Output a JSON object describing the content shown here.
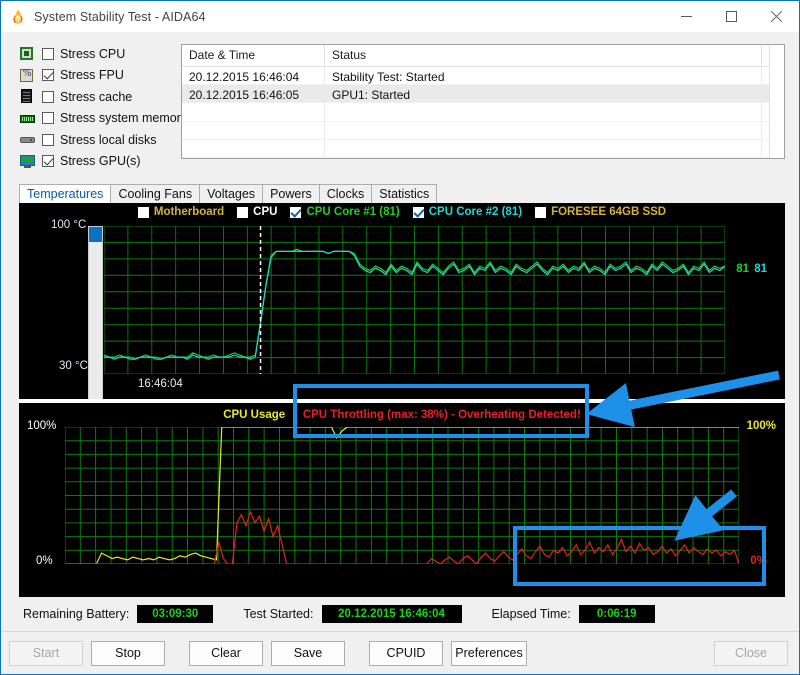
{
  "window": {
    "title": "System Stability Test - AIDA64",
    "icon": "flame-icon",
    "minimize": "—",
    "maximize": "□",
    "close": "✕"
  },
  "stress_options": [
    {
      "label": "Stress CPU",
      "checked": false,
      "icon": "cpu-chip-icon"
    },
    {
      "label": "Stress FPU",
      "checked": true,
      "icon": "fpu-chip-icon"
    },
    {
      "label": "Stress cache",
      "checked": false,
      "icon": "cache-icon"
    },
    {
      "label": "Stress system memory",
      "checked": false,
      "icon": "memory-module-icon"
    },
    {
      "label": "Stress local disks",
      "checked": false,
      "icon": "hard-disk-icon"
    },
    {
      "label": "Stress GPU(s)",
      "checked": true,
      "icon": "gpu-monitor-icon"
    }
  ],
  "log": {
    "columns": [
      "Date & Time",
      "Status"
    ],
    "rows": [
      {
        "datetime": "20.12.2015 16:46:04",
        "status": "Stability Test: Started"
      },
      {
        "datetime": "20.12.2015 16:46:05",
        "status": "GPU1: Started"
      }
    ],
    "empty_rows": 3
  },
  "tabs": [
    {
      "label": "Temperatures",
      "active": true
    },
    {
      "label": "Cooling Fans",
      "active": false
    },
    {
      "label": "Voltages",
      "active": false
    },
    {
      "label": "Powers",
      "active": false
    },
    {
      "label": "Clocks",
      "active": false
    },
    {
      "label": "Statistics",
      "active": false
    }
  ],
  "legend": [
    {
      "label": "Motherboard",
      "color": "#d6b23a",
      "checked": false
    },
    {
      "label": "CPU",
      "color": "#ffffff",
      "checked": false
    },
    {
      "label": "CPU Core #1 (81)",
      "color": "#21cf21",
      "checked": true
    },
    {
      "label": "CPU Core #2 (81)",
      "color": "#1fd8d8",
      "checked": true
    },
    {
      "label": "FORESEE 64GB SSD",
      "color": "#d6b23a",
      "checked": false
    }
  ],
  "temp_chart": {
    "y_top": "100 °C",
    "y_bottom": "30 °C",
    "x_marker": "16:46:04",
    "right_labels": [
      {
        "text": "81",
        "color": "#21cf21"
      },
      {
        "text": "81",
        "color": "#1fd8d8"
      }
    ]
  },
  "usage_chart": {
    "title_usage": "CPU Usage",
    "title_sep": "|",
    "title_throttle": "CPU Throttling (max: 38%) - Overheating Detected!",
    "usage_color": "#e8e82a",
    "throttle_color": "#e82020",
    "y_top_left": "100%",
    "y_bottom_left": "0%",
    "y_top_right": "100%",
    "y_bottom_right": "0%"
  },
  "status": {
    "battery_label": "Remaining Battery:",
    "battery_value": "03:09:30",
    "started_label": "Test Started:",
    "started_value": "20.12.2015 16:46:04",
    "elapsed_label": "Elapsed Time:",
    "elapsed_value": "0:06:19"
  },
  "buttons": [
    {
      "label": "Start",
      "enabled": false
    },
    {
      "label": "Stop",
      "enabled": true
    },
    {
      "label": "Clear",
      "enabled": true
    },
    {
      "label": "Save",
      "enabled": true
    },
    {
      "label": "CPUID",
      "enabled": true
    },
    {
      "label": "Preferences",
      "enabled": true
    },
    {
      "label": "Close",
      "enabled": false
    }
  ],
  "annotations": {
    "accent_color": "#1e90e8",
    "box1": "throttling-warning-highlight",
    "box2": "throttling-spikes-highlight",
    "arrow1": "arrow-pointing-to-warning",
    "arrow2": "arrow-pointing-to-spikes"
  },
  "chart_data": {
    "type": "line",
    "title": "AIDA64 System Stability Test",
    "charts": [
      {
        "name": "temperatures",
        "ylabel": "°C",
        "ylim": [
          30,
          100
        ],
        "xlabel": "16:46:04",
        "grid": true,
        "legend_position": "top",
        "series": [
          {
            "name": "CPU Core #1",
            "color": "#21cf21",
            "current": 81,
            "values": [
              39,
              38,
              38,
              39,
              38,
              38,
              37,
              38,
              39,
              38,
              38,
              37,
              38,
              39,
              38,
              38,
              38,
              40,
              39,
              38,
              38,
              39,
              38,
              38,
              39,
              40,
              39,
              38,
              38,
              39,
              55,
              72,
              86,
              88,
              88,
              88,
              88,
              89,
              88,
              88,
              88,
              88,
              88,
              87,
              88,
              88,
              88,
              88,
              87,
              82,
              80,
              79,
              81,
              80,
              78,
              82,
              79,
              81,
              80,
              78,
              83,
              80,
              79,
              82,
              80,
              78,
              81,
              83,
              79,
              80,
              82,
              78,
              81,
              80,
              83,
              79,
              81,
              80,
              78,
              82,
              80,
              79,
              81,
              83,
              80,
              78,
              81,
              80,
              82,
              79,
              81,
              80,
              83,
              79,
              81,
              80,
              78,
              82,
              80,
              81,
              83,
              79,
              81,
              80,
              78,
              82,
              80,
              83,
              81,
              79,
              80,
              82,
              78,
              81,
              80,
              83,
              79,
              81,
              80,
              81
            ]
          },
          {
            "name": "CPU Core #2",
            "color": "#1fd8d8",
            "current": 81,
            "values": [
              38,
              38,
              37,
              38,
              38,
              37,
              37,
              38,
              38,
              38,
              37,
              37,
              38,
              38,
              38,
              38,
              37,
              39,
              38,
              38,
              37,
              38,
              38,
              38,
              38,
              39,
              38,
              38,
              37,
              38,
              54,
              71,
              85,
              88,
              88,
              88,
              88,
              88,
              88,
              88,
              88,
              88,
              88,
              87,
              88,
              88,
              88,
              88,
              86,
              81,
              79,
              78,
              80,
              79,
              77,
              81,
              78,
              80,
              79,
              77,
              82,
              79,
              78,
              81,
              79,
              77,
              80,
              82,
              78,
              79,
              81,
              77,
              80,
              79,
              82,
              78,
              80,
              79,
              77,
              81,
              79,
              78,
              80,
              82,
              79,
              77,
              80,
              79,
              81,
              78,
              80,
              79,
              82,
              78,
              80,
              79,
              77,
              81,
              79,
              80,
              82,
              78,
              80,
              79,
              77,
              81,
              79,
              82,
              80,
              78,
              79,
              81,
              77,
              80,
              79,
              82,
              78,
              80,
              79,
              81
            ]
          }
        ]
      },
      {
        "name": "cpu-usage-and-throttling",
        "ylabel": "%",
        "ylim": [
          0,
          100
        ],
        "grid": true,
        "series": [
          {
            "name": "CPU Usage",
            "color": "#e8e82a",
            "current": 100,
            "values": [
              0,
              0,
              0,
              0,
              0,
              0,
              0,
              8,
              6,
              4,
              5,
              4,
              3,
              5,
              4,
              3,
              4,
              3,
              5,
              4,
              3,
              4,
              6,
              5,
              7,
              8,
              6,
              5,
              4,
              3,
              100,
              100,
              100,
              100,
              100,
              100,
              100,
              100,
              100,
              100,
              100,
              100,
              100,
              100,
              100,
              100,
              100,
              100,
              100,
              100,
              100,
              100,
              92,
              97,
              100,
              100,
              100,
              100,
              100,
              100,
              100,
              100,
              100,
              100,
              100,
              100,
              100,
              100,
              100,
              100,
              100,
              100,
              100,
              100,
              100,
              100,
              100,
              100,
              100,
              100,
              100,
              100,
              100,
              100,
              100,
              100,
              100,
              100,
              100,
              100,
              100,
              100,
              100,
              100,
              100,
              100,
              100,
              100,
              100,
              100,
              100,
              100,
              100,
              100,
              100,
              100,
              100,
              100,
              100,
              100,
              100,
              100,
              100,
              100,
              100,
              100,
              100,
              100,
              100,
              100,
              100,
              100,
              100,
              100,
              100,
              100,
              100,
              100,
              100,
              100
            ]
          },
          {
            "name": "CPU Throttling",
            "color": "#e82020",
            "max": 38,
            "current": 0,
            "values": [
              0,
              0,
              0,
              0,
              0,
              0,
              0,
              0,
              0,
              0,
              0,
              0,
              0,
              0,
              0,
              0,
              0,
              0,
              0,
              0,
              0,
              0,
              0,
              0,
              0,
              0,
              0,
              0,
              0,
              0,
              0,
              0,
              0,
              0,
              16,
              4,
              0,
              0,
              30,
              36,
              28,
              38,
              30,
              35,
              24,
              33,
              20,
              28,
              14,
              0,
              0,
              0,
              0,
              0,
              0,
              0,
              0,
              0,
              0,
              0,
              0,
              0,
              0,
              0,
              0,
              0,
              0,
              0,
              0,
              0,
              0,
              0,
              0,
              0,
              0,
              0,
              0,
              0,
              0,
              0,
              0,
              4,
              2,
              0,
              3,
              5,
              2,
              0,
              4,
              6,
              3,
              0,
              5,
              8,
              4,
              2,
              6,
              9,
              5,
              3,
              7,
              11,
              6,
              4,
              9,
              13,
              7,
              5,
              10,
              8,
              12,
              6,
              9,
              14,
              7,
              10,
              16,
              8,
              12,
              9,
              14,
              7,
              11,
              18,
              9,
              13,
              8,
              15,
              10,
              12,
              7,
              9,
              13,
              8,
              11,
              6,
              10,
              14,
              8,
              12,
              9,
              7,
              11,
              8,
              10,
              6,
              9,
              7,
              10,
              0
            ]
          }
        ],
        "annotation": "CPU Throttling (max: 38%) - Overheating Detected!"
      }
    ]
  }
}
